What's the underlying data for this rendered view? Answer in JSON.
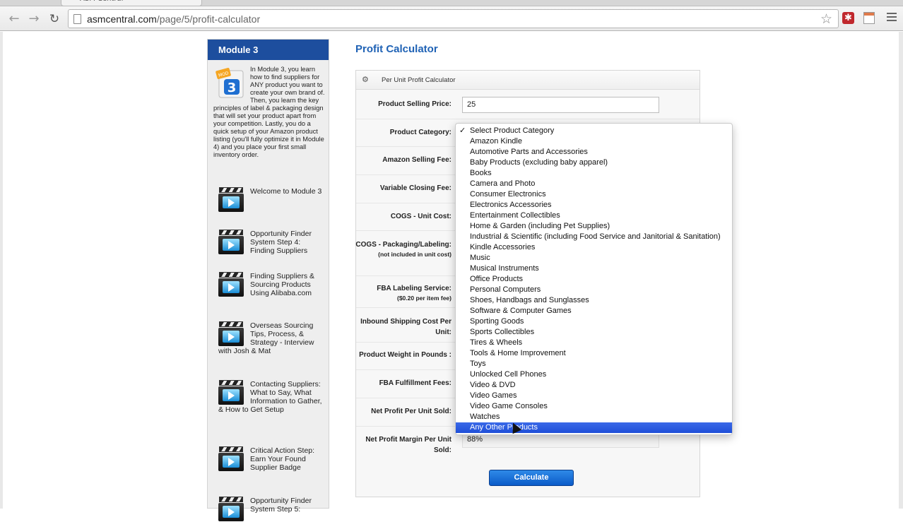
{
  "browser": {
    "tab_title": "ASM Central",
    "url_host": "asmcentral.com",
    "url_path": "/page/5/profit-calculator"
  },
  "sidebar": {
    "title": "Module 3",
    "badge_text": "MOD 3",
    "description": "In Module 3, you learn how to find suppliers for ANY product you want to create your own brand of. Then, you learn the key principles of label & packaging design that will set your product apart from your competition. Lastly, you do a quick setup of your Amazon product listing (you'll fully optimize it in Module 4) and you place your first small inventory order.",
    "lessons": [
      {
        "label": "Welcome to Module 3"
      },
      {
        "label": "Opportunity Finder System Step 4: Finding Suppliers"
      },
      {
        "label": "Finding Suppliers & Sourcing Products Using Alibaba.com"
      },
      {
        "label": "Overseas Sourcing Tips, Process, & Strategy - Interview with Josh & Mat"
      },
      {
        "label": "Contacting Suppliers: What to Say, What Information to Gather, & How to Get Setup"
      },
      {
        "label": "Critical Action Step: Earn Your Found Supplier Badge"
      },
      {
        "label": "Opportunity Finder System Step 5:"
      }
    ]
  },
  "main": {
    "title": "Profit Calculator",
    "panel_title": "Per Unit Profit Calculator",
    "fields": {
      "selling_price_label": "Product Selling Price:",
      "selling_price_value": "25",
      "category_label": "Product Category:",
      "amazon_fee_label": "Amazon Selling Fee:",
      "closing_fee_label": "Variable Closing Fee:",
      "cogs_unit_label": "COGS - Unit Cost:",
      "cogs_pack_label": "COGS - Packaging/Labeling:",
      "cogs_pack_note": "(not included in unit cost)",
      "fba_label_label": "FBA Labeling Service:",
      "fba_label_note": "($0.20 per item fee)",
      "inbound_label": "Inbound Shipping Cost Per Unit:",
      "weight_label": "Product Weight in Pounds :",
      "fba_fees_label": "FBA Fulfillment Fees:",
      "net_profit_label": "Net Profit Per Unit Sold:",
      "net_margin_label": "Net Profit Margin Per Unit Sold:",
      "net_margin_value": "88%"
    },
    "calculate_label": "Calculate"
  },
  "dropdown": {
    "options": [
      "Select Product Category",
      "Amazon Kindle",
      "Automotive Parts and Accessories",
      "Baby Products (excluding baby apparel)",
      "Books",
      "Camera and Photo",
      "Consumer Electronics",
      "Electronics Accessories",
      "Entertainment Collectibles",
      "Home & Garden (including Pet Supplies)",
      "Industrial & Scientific (including Food Service and Janitorial & Sanitation)",
      "Kindle Accessories",
      "Music",
      "Musical Instruments",
      "Office Products",
      "Personal Computers",
      "Shoes, Handbags and Sunglasses",
      "Software & Computer Games",
      "Sporting Goods",
      "Sports Collectibles",
      "Tires & Wheels",
      "Tools & Home Improvement",
      "Toys",
      "Unlocked Cell Phones",
      "Video & DVD",
      "Video Games",
      "Video Game Consoles",
      "Watches",
      "Any Other Products"
    ],
    "checked_index": 0,
    "highlighted_index": 28,
    "check_glyph": "✓"
  },
  "colors": {
    "sidebar_header": "#1d4e9e",
    "title_blue": "#1f62b5",
    "button_blue": "#0b5bc8",
    "highlight": "#1f4fd8"
  }
}
